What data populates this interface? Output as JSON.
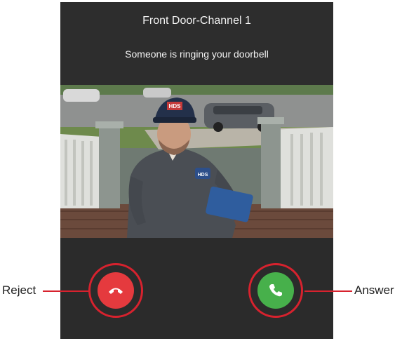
{
  "header": {
    "title": "Front Door-Channel 1",
    "subtitle": "Someone is ringing your doorbell"
  },
  "video": {
    "description_icon": "camera-feed",
    "badge_text": "HDS"
  },
  "actions": {
    "reject": {
      "icon": "hang-up-icon",
      "callout": "Reject",
      "color": "#e53a3e"
    },
    "answer": {
      "icon": "phone-icon",
      "callout": "Answer",
      "color": "#47b04b"
    }
  },
  "accent": "#d7222e"
}
